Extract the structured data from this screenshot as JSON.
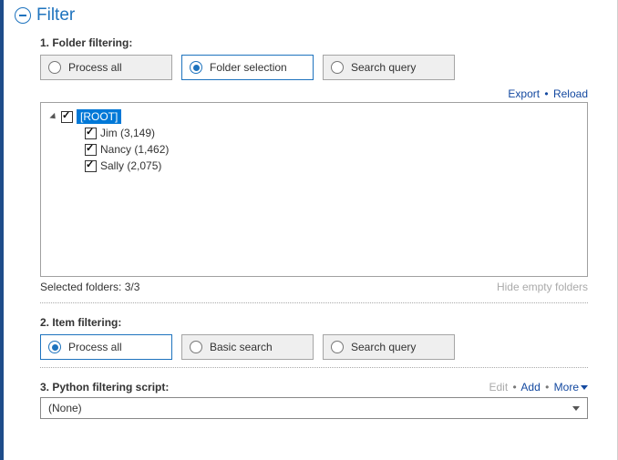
{
  "header": {
    "title": "Filter"
  },
  "section1": {
    "label": "1. Folder filtering:",
    "options": {
      "process_all": "Process all",
      "folder_selection": "Folder selection",
      "search_query": "Search query"
    },
    "links": {
      "export": "Export",
      "reload": "Reload"
    },
    "tree": {
      "root": "[ROOT]",
      "children": [
        {
          "label": "Jim (3,149)"
        },
        {
          "label": "Nancy (1,462)"
        },
        {
          "label": "Sally (2,075)"
        }
      ]
    },
    "status": "Selected folders: 3/3",
    "hide_empty": "Hide empty folders"
  },
  "section2": {
    "label": "2. Item filtering:",
    "options": {
      "process_all": "Process all",
      "basic_search": "Basic search",
      "search_query": "Search query"
    }
  },
  "section3": {
    "label": "3. Python filtering script:",
    "links": {
      "edit": "Edit",
      "add": "Add",
      "more": "More"
    },
    "selected": "(None)"
  }
}
